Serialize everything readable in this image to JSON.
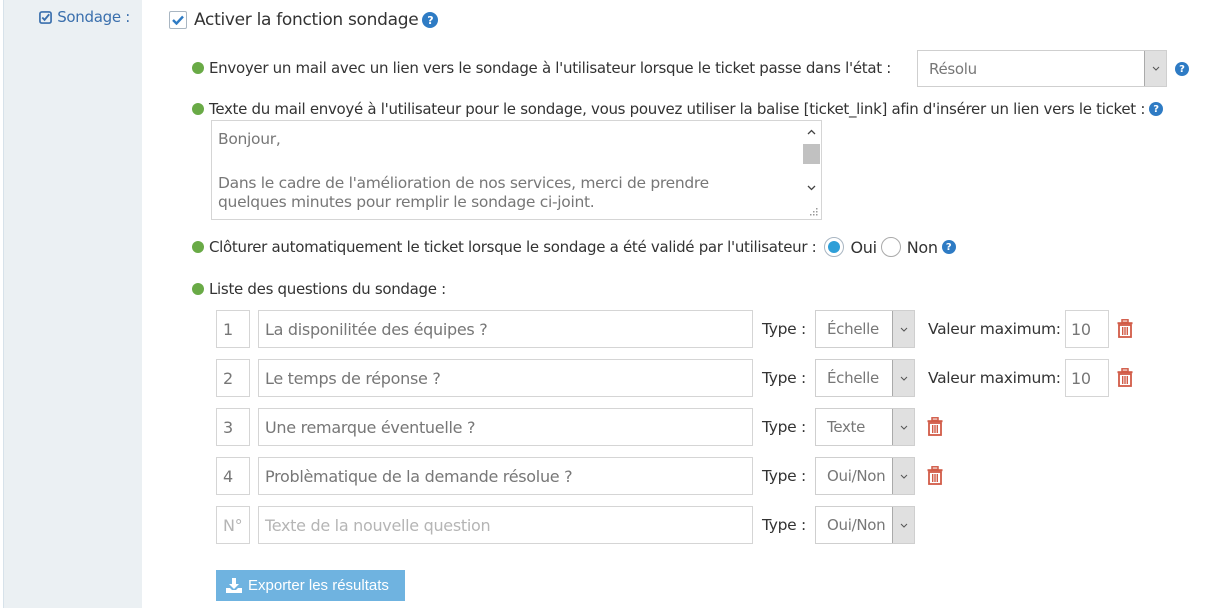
{
  "section": {
    "label": "Sondage :",
    "icon": "check-square-icon"
  },
  "enable": {
    "label": "Activer la fonction sondage",
    "checked": true
  },
  "send_mail": {
    "label": "Envoyer un mail avec un lien vers le sondage à l'utilisateur lorsque le ticket passe dans l'état :",
    "state_value": "Résolu"
  },
  "mail_text": {
    "label": "Texte du mail envoyé à l'utilisateur pour le sondage, vous pouvez utiliser la balise [ticket_link] afin d'insérer un lien vers le ticket :",
    "lines": [
      "Bonjour,",
      "",
      "Dans le cadre de l'amélioration de nos services, merci de prendre",
      "quelques minutes pour remplir le sondage ci-joint."
    ]
  },
  "auto_close": {
    "label": "Clôturer automatiquement le ticket lorsque le sondage a été validé par l'utilisateur :",
    "options": [
      "Oui",
      "Non"
    ],
    "selected": "Oui"
  },
  "questions": {
    "label": "Liste des questions du sondage :",
    "type_label": "Type :",
    "max_label": "Valeur maximum:",
    "items": [
      {
        "num": "1",
        "text": "La disponilitée des équipes ?",
        "type": "Échelle",
        "max": "10"
      },
      {
        "num": "2",
        "text": "Le temps de réponse ?",
        "type": "Échelle",
        "max": "10"
      },
      {
        "num": "3",
        "text": "Une remarque éventuelle ?",
        "type": "Texte"
      },
      {
        "num": "4",
        "text": "Problèmatique de la demande résolue ?",
        "type": "Oui/Non"
      }
    ],
    "new": {
      "num_placeholder": "N°",
      "text_placeholder": "Texte de la nouvelle question",
      "type": "Oui/Non"
    }
  },
  "export_button": {
    "label": "Exporter les résultats",
    "icon": "download-icon"
  },
  "colors": {
    "accent": "#2e7bc4",
    "bullet": "#69aa46",
    "danger": "#d15b47",
    "button": "#6fb3e0",
    "sidebar": "#ebf0f3"
  }
}
